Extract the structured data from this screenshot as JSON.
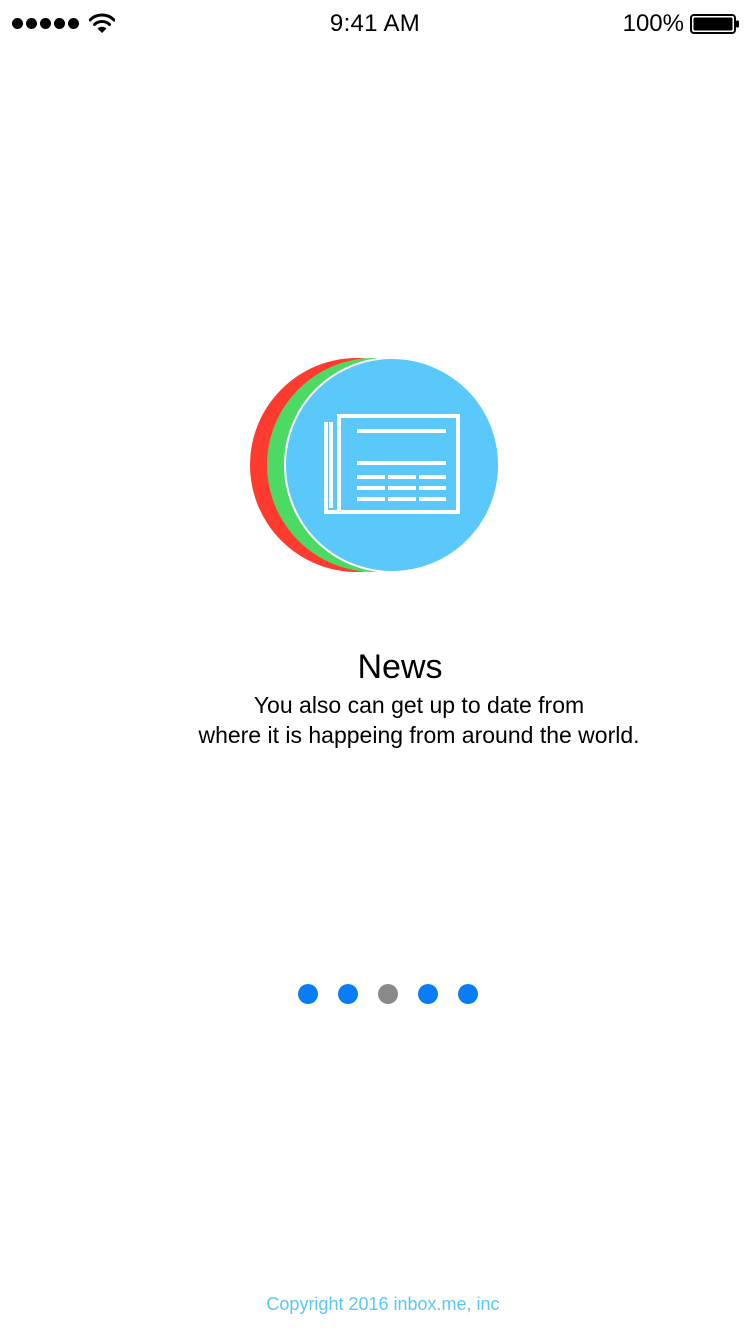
{
  "status_bar": {
    "time": "9:41 AM",
    "battery_percent": "100%",
    "signal_icon": "signal-dots-icon",
    "wifi_icon": "wifi-icon",
    "battery_icon": "battery-icon"
  },
  "hero": {
    "icon": "newspaper-icon",
    "colors": {
      "back_circle": "#ff3b30",
      "middle_circle": "#4cd964",
      "front_circle": "#5ac8fa",
      "glyph": "#ffffff"
    }
  },
  "onboarding": {
    "title": "News",
    "description_line1": "You also can get up to date from",
    "description_line2": "where it is happeing from around the world."
  },
  "pager": {
    "page_count": 5,
    "current_page": 3,
    "dot_color": "#0a7cf5",
    "active_dot_color": "#8a8a8a"
  },
  "footer": {
    "copyright": "Copyright 2016 inbox.me, inc"
  }
}
